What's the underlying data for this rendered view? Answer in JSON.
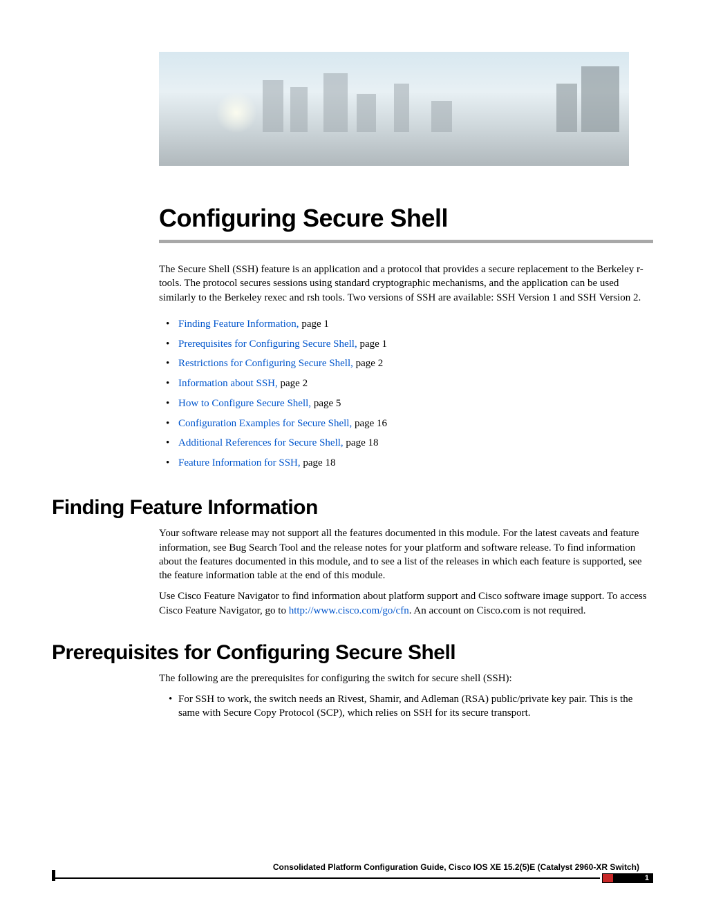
{
  "main_title": "Configuring Secure Shell",
  "intro": "The Secure Shell (SSH) feature is an application and a protocol that provides a secure replacement to the Berkeley r-tools. The protocol secures sessions using standard cryptographic mechanisms, and the application can be used similarly to the Berkeley rexec and rsh tools. Two versions of SSH are available: SSH Version 1 and SSH Version 2.",
  "toc": [
    {
      "text": "Finding Feature Information,",
      "page": "page  1"
    },
    {
      "text": "Prerequisites for Configuring Secure Shell,",
      "page": "page  1"
    },
    {
      "text": "Restrictions for Configuring Secure Shell,",
      "page": "page  2"
    },
    {
      "text": "Information about SSH,",
      "page": "page  2"
    },
    {
      "text": "How to Configure Secure Shell,",
      "page": "page  5"
    },
    {
      "text": "Configuration Examples for Secure Shell,",
      "page": "page  16"
    },
    {
      "text": "Additional References for Secure Shell,",
      "page": "page  18"
    },
    {
      "text": "Feature Information for SSH,",
      "page": "page  18"
    }
  ],
  "section1": {
    "title": "Finding Feature Information",
    "p1": "Your software release may not support all the features documented in this module. For the latest caveats and feature information, see Bug Search Tool and the release notes for your platform and software release. To find information about the features documented in this module, and to see a list of the releases in which each feature is supported, see the feature information table at the end of this module.",
    "p2a": "Use Cisco Feature Navigator to find information about platform support and Cisco software image support. To access Cisco Feature Navigator, go to ",
    "link": "http://www.cisco.com/go/cfn",
    "p2b": ". An account on Cisco.com is not required."
  },
  "section2": {
    "title": "Prerequisites for Configuring Secure Shell",
    "p1": "The following are the prerequisites for configuring the switch for secure shell (SSH):",
    "items": [
      "For SSH to work, the switch needs an Rivest, Shamir, and Adleman (RSA) public/private key pair. This is the same with Secure Copy Protocol (SCP), which relies on SSH for its secure transport."
    ]
  },
  "footer": {
    "line": "Consolidated Platform Configuration Guide, Cisco IOS XE 15.2(5)E (Catalyst 2960-XR Switch)",
    "page": "1"
  }
}
